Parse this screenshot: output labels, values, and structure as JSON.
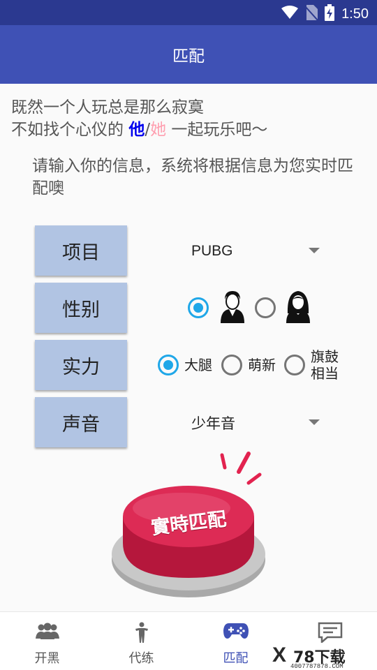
{
  "status": {
    "time": "1:50"
  },
  "appbar": {
    "title": "匹配"
  },
  "intro": {
    "line1": "既然一个人玩总是那么寂寞",
    "line2_prefix": "不如找个心仪的 ",
    "he": "他",
    "slash": "/",
    "she": "她",
    "line2_suffix": " 一起玩乐吧～"
  },
  "prompt": {
    "text": "请输入你的信息，系统将根据信息为您实时匹配噢"
  },
  "form": {
    "project": {
      "label": "项目",
      "value": "PUBG"
    },
    "gender": {
      "label": "性别",
      "selected": "male"
    },
    "skill": {
      "label": "实力",
      "options": [
        "大腿",
        "萌新",
        "旗鼓",
        "相当"
      ],
      "selected": "大腿"
    },
    "voice": {
      "label": "声音",
      "value": "少年音"
    }
  },
  "match_button": {
    "label": "實時匹配"
  },
  "nav": [
    {
      "label": "开黑",
      "icon": "group-icon"
    },
    {
      "label": "代练",
      "icon": "person-icon"
    },
    {
      "label": "匹配",
      "icon": "gamepad-icon",
      "active": true
    },
    {
      "label": "",
      "icon": "chat-icon"
    }
  ],
  "watermark": {
    "text": "78下载",
    "url": "4007787878.COM"
  },
  "colors": {
    "primary": "#3f51b5",
    "status_bar": "#2b3990",
    "radio_accent": "#1fa7e8",
    "label_box": "#b1c4e3",
    "button_red": "#d92c53"
  }
}
